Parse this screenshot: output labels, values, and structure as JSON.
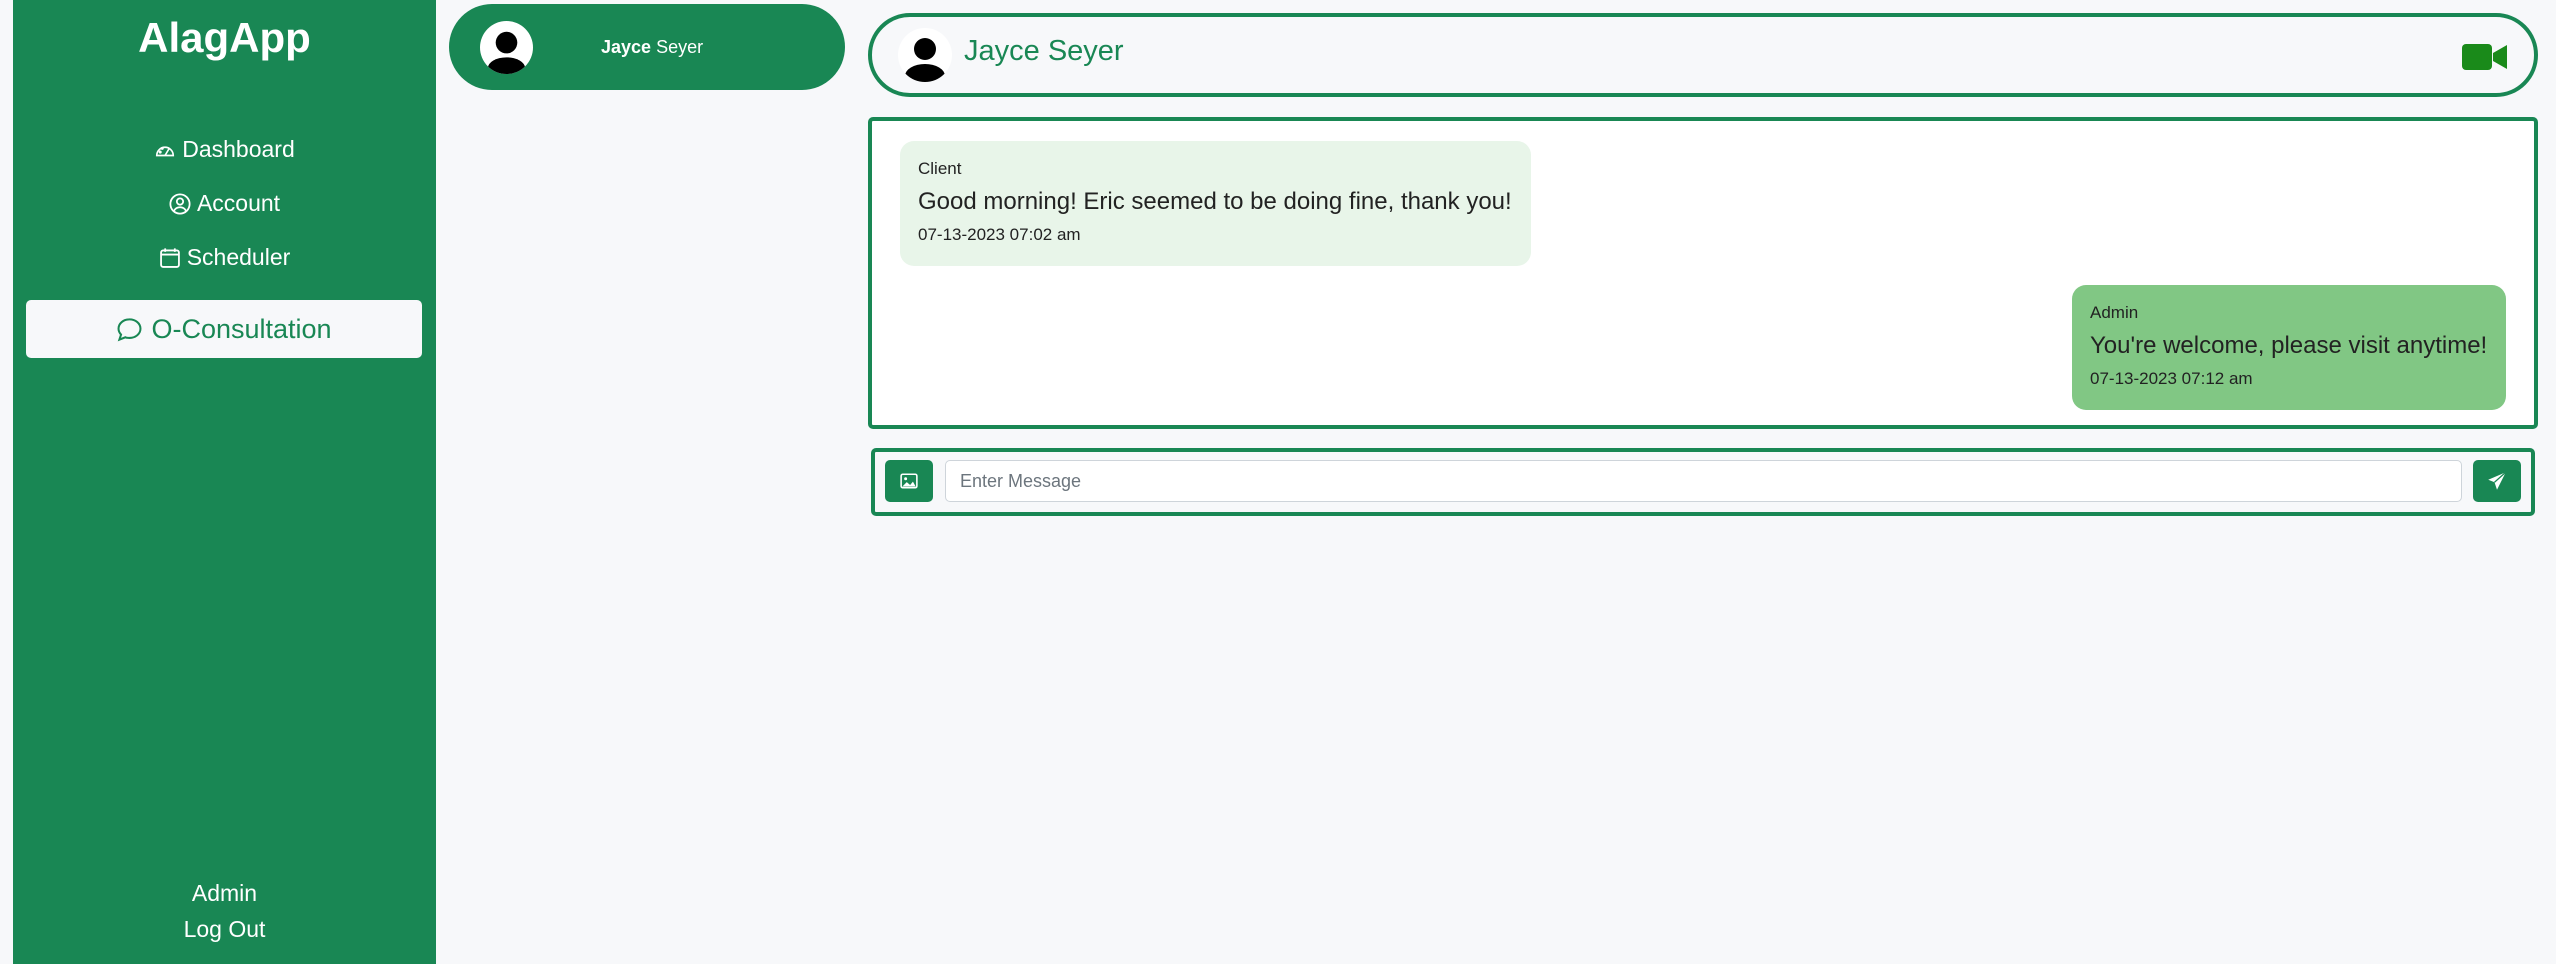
{
  "sidebar": {
    "brand": "AlagApp",
    "items": [
      {
        "label": "Dashboard",
        "icon": "speedometer-icon"
      },
      {
        "label": "Account",
        "icon": "person-circle-icon"
      },
      {
        "label": "Scheduler",
        "icon": "calendar-icon"
      },
      {
        "label": "O-Consultation",
        "icon": "chat-bubble-icon",
        "active": true
      }
    ],
    "user": "Admin",
    "logout": "Log Out"
  },
  "contacts": [
    {
      "first": "Jayce",
      "last": "Seyer",
      "avatar": "user-avatar-icon"
    }
  ],
  "chat": {
    "header_name": "Jayce Seyer",
    "video_icon": "video-camera-icon",
    "messages": [
      {
        "sender": "Client",
        "text": "Good morning! Eric seemed to be doing fine, thank you!",
        "time": "07-13-2023 07:02 am"
      },
      {
        "sender": "Admin",
        "text": "You're welcome, please visit anytime!",
        "time": "07-13-2023 07:12 am"
      }
    ],
    "input_placeholder": "Enter Message",
    "image_button_icon": "image-icon",
    "send_button_icon": "send-icon"
  },
  "colors": {
    "brand_green": "#198754",
    "client_bubble": "#e8f5e9",
    "admin_bubble": "#81c784",
    "video_icon": "#1a8a1a"
  }
}
